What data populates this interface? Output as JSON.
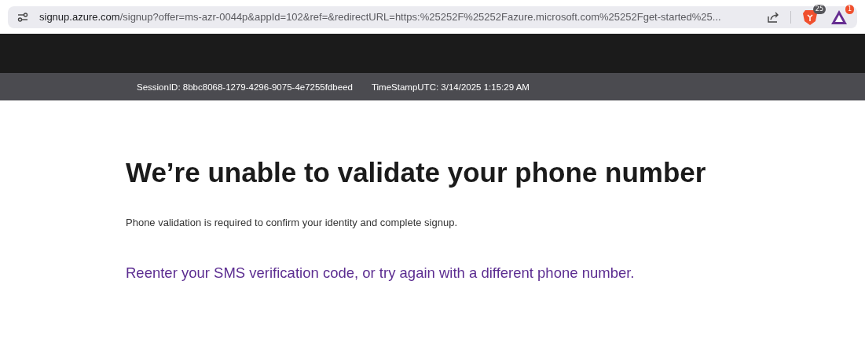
{
  "browser": {
    "url_host": "signup.azure.com",
    "url_path": "/signup?offer=ms-azr-0044p&appId=102&ref=&redirectURL=https:%25252F%25252Fazure.microsoft.com%25252Fget-started%25...",
    "shields_count": "25",
    "rewards_count": "1"
  },
  "session_bar": {
    "session_id": "SessionID: 8bbc8068-1279-4296-9075-4e7255fdbeed",
    "timestamp": "TimeStampUTC: 3/14/2025 1:15:29 AM"
  },
  "content": {
    "heading": "We’re unable to validate your phone number",
    "description": "Phone validation is required to confirm your identity and complete signup.",
    "link": "Reenter your SMS verification code, or try again with a different phone number."
  }
}
